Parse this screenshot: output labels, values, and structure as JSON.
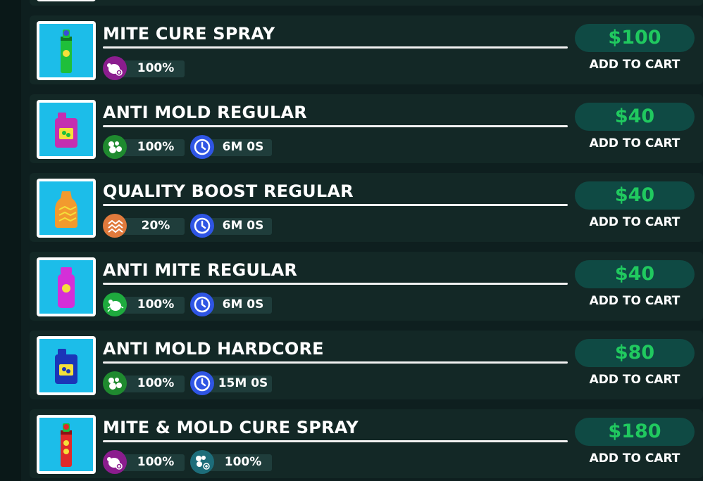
{
  "colors": {
    "background": "#0e1f1f",
    "row": "#132826",
    "price_pill": "#0f4a44",
    "price_text": "#20c95f",
    "thumb_bg": "#1cbde9",
    "stat_bg": "#1f3d3b",
    "mite_icon": "#8b1d8e",
    "mold_icon": "#1f8a2f",
    "timer_icon": "#2f55e4",
    "boost_icon": "#e07a3c",
    "mite_green_icon": "#1eaa3e",
    "mold_teal_icon": "#1d6d7a"
  },
  "products": [
    {
      "name": "MITE CURE SPRAY",
      "image": "green-spray-can-icon",
      "price": "$100",
      "add_to_cart": "ADD TO CART",
      "stats": [
        {
          "icon": "mite-cure-icon",
          "value": "100%"
        }
      ]
    },
    {
      "name": "ANTI MOLD REGULAR",
      "image": "pink-jerrycan-icon",
      "price": "$40",
      "add_to_cart": "ADD TO CART",
      "stats": [
        {
          "icon": "mold-icon",
          "value": "100%"
        },
        {
          "icon": "timer-icon",
          "value": "6M 0S"
        }
      ]
    },
    {
      "name": "QUALITY BOOST REGULAR",
      "image": "orange-bottle-icon",
      "price": "$40",
      "add_to_cart": "ADD TO CART",
      "stats": [
        {
          "icon": "quality-boost-icon",
          "value": "20%"
        },
        {
          "icon": "timer-icon",
          "value": "6M 0S"
        }
      ]
    },
    {
      "name": "ANTI MITE REGULAR",
      "image": "magenta-bottle-icon",
      "price": "$40",
      "add_to_cart": "ADD TO CART",
      "stats": [
        {
          "icon": "anti-mite-icon",
          "value": "100%"
        },
        {
          "icon": "timer-icon",
          "value": "6M 0S"
        }
      ]
    },
    {
      "name": "ANTI MOLD HARDCORE",
      "image": "blue-jerrycan-icon",
      "price": "$80",
      "add_to_cart": "ADD TO CART",
      "stats": [
        {
          "icon": "mold-icon",
          "value": "100%"
        },
        {
          "icon": "timer-icon",
          "value": "15M 0S"
        }
      ]
    },
    {
      "name": "MITE & MOLD CURE SPRAY",
      "image": "red-spray-can-icon",
      "price": "$180",
      "add_to_cart": "ADD TO CART",
      "stats": [
        {
          "icon": "mite-cure-icon",
          "value": "100%"
        },
        {
          "icon": "mold-cure-icon",
          "value": "100%"
        }
      ]
    }
  ]
}
